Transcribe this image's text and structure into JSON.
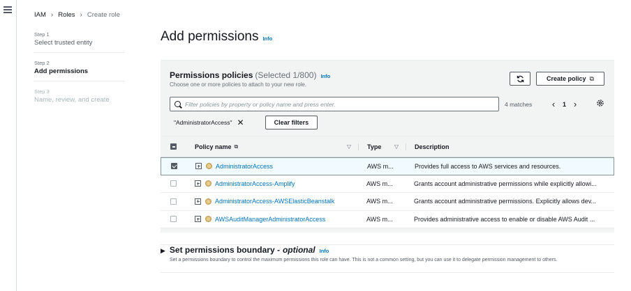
{
  "breadcrumb": {
    "items": [
      "IAM",
      "Roles",
      "Create role"
    ]
  },
  "steps": [
    {
      "num": "Step 1",
      "title": "Select trusted entity"
    },
    {
      "num": "Step 2",
      "title": "Add permissions"
    },
    {
      "num": "Step 3",
      "title": "Name, review, and create"
    }
  ],
  "page": {
    "title": "Add permissions",
    "info": "Info"
  },
  "panel": {
    "title": "Permissions policies",
    "count": "(Selected 1/800)",
    "info": "Info",
    "subtitle": "Choose one or more policies to attach to your new role.",
    "create_policy_label": "Create policy",
    "search_placeholder": "Filter policies by property or policy name and press enter.",
    "matches": "4 matches",
    "page_number": "1",
    "filter_chip": "\"AdministratorAccess\"",
    "clear_filters_label": "Clear filters"
  },
  "table": {
    "headers": {
      "name": "Policy name",
      "type": "Type",
      "description": "Description"
    },
    "rows": [
      {
        "name": "AdministratorAccess",
        "type": "AWS m...",
        "description": "Provides full access to AWS services and resources.",
        "selected": true
      },
      {
        "name": "AdministratorAccess-Amplify",
        "type": "AWS m...",
        "description": "Grants account administrative permissions while explicitly allowi...",
        "selected": false
      },
      {
        "name": "AdministratorAccess-AWSElasticBeanstalk",
        "type": "AWS m...",
        "description": "Grants account administrative permissions. Explicitly allows dev...",
        "selected": false
      },
      {
        "name": "AWSAuditManagerAdministratorAccess",
        "type": "AWS m...",
        "description": "Provides administrative access to enable or disable AWS Audit ...",
        "selected": false
      }
    ]
  },
  "boundary": {
    "title": "Set permissions boundary -",
    "title_optional": "optional",
    "info": "Info",
    "description": "Set a permissions boundary to control the maximum permissions this role can have. This is not a common setting, but you can use it to delegate permission management to others."
  },
  "colors": {
    "link": "#0073bb",
    "panel_bg": "#f2f3f3",
    "selected_row_bg": "#f1faff"
  }
}
